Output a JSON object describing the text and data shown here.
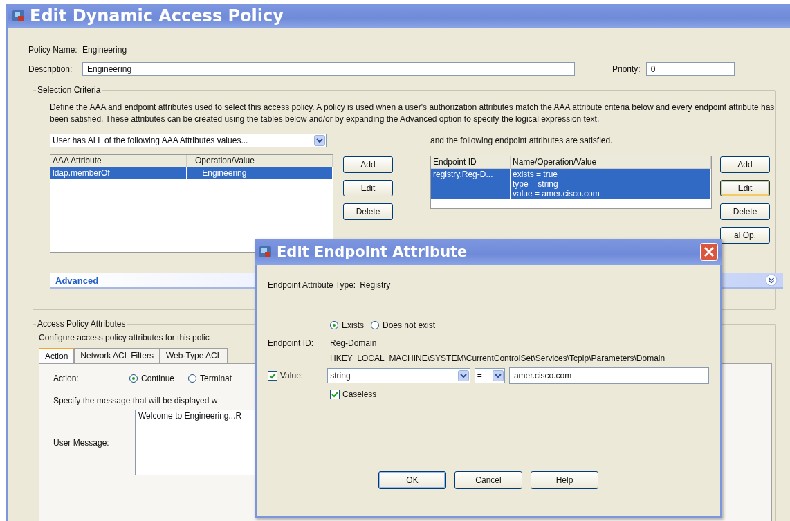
{
  "window": {
    "title": "Edit Dynamic Access Policy"
  },
  "policy_name": {
    "label": "Policy Name:",
    "value": "Engineering"
  },
  "description": {
    "label": "Description:",
    "value": "Engineering"
  },
  "priority": {
    "label": "Priority:",
    "value": "0"
  },
  "selection_criteria": {
    "title": "Selection Criteria",
    "text": "Define the AAA and endpoint attributes used to select this access policy. A policy is used when a user's authorization attributes match the AAA attribute criteria below and every endpoint attribute has been satisfied. These attributes can be created using the tables below and/or by expanding the Advanced option to specify the logical expression text.",
    "aaa_dropdown": "User has ALL of the following AAA Attributes values...",
    "aaa_table": {
      "columns": [
        "AAA Attribute",
        "Operation/Value"
      ],
      "rows": [
        {
          "cells": [
            "ldap.memberOf",
            "=  Engineering"
          ],
          "selected": true
        }
      ]
    },
    "aaa_buttons": [
      {
        "label": "Add",
        "focused": false
      },
      {
        "label": "Edit",
        "focused": false
      },
      {
        "label": "Delete",
        "focused": false
      }
    ],
    "endpoint_caption": "and the following endpoint attributes are satisfied.",
    "endpoint_table": {
      "columns": [
        "Endpoint ID",
        "Name/Operation/Value"
      ],
      "rows": [
        {
          "cells": [
            "registry.Reg-D...",
            [
              "exists = true",
              "type = string",
              "value = amer.cisco.com"
            ]
          ],
          "selected": true
        }
      ]
    },
    "endpoint_buttons": [
      {
        "label": "Add",
        "focused": false
      },
      {
        "label": "Edit",
        "focused": true
      },
      {
        "label": "Delete",
        "focused": false
      },
      {
        "label": "al Op.",
        "focused": false
      }
    ],
    "advanced": {
      "label": "Advanced",
      "expanded": false
    }
  },
  "access_policy_attributes": {
    "title": "Access Policy Attributes",
    "text": "Configure access policy attributes for this polic",
    "tabs": [
      {
        "label": "Action",
        "selected": true
      },
      {
        "label": "Network ACL Filters",
        "selected": false
      },
      {
        "label": "Web-Type ACL",
        "selected": false
      }
    ],
    "action": {
      "label": "Action:",
      "options": [
        {
          "label": "Continue",
          "selected": true
        },
        {
          "label": "Terminat",
          "selected": false
        }
      ]
    },
    "message_prompt": "Specify the message that will be displayed w",
    "user_message": {
      "label": "User Message:",
      "value": "Welcome to Engineering...R"
    }
  },
  "dialog": {
    "title": "Edit Endpoint Attribute",
    "type_label": "Endpoint Attribute Type:",
    "type_value": "Registry",
    "existence": [
      {
        "label": "Exists",
        "selected": true
      },
      {
        "label": "Does not exist",
        "selected": false
      }
    ],
    "endpoint_id_label": "Endpoint ID:",
    "endpoint_id": "Reg-Domain",
    "registry_path": "HKEY_LOCAL_MACHINE\\SYSTEM\\CurrentControlSet\\Services\\Tcpip\\Parameters\\Domain",
    "value_checkbox": {
      "label": "Value:",
      "checked": true
    },
    "value_type": "string",
    "operator": "=",
    "value": "amer.cisco.com",
    "caseless": {
      "label": "Caseless",
      "checked": true
    },
    "buttons": [
      {
        "label": "OK",
        "focused": true
      },
      {
        "label": "Cancel",
        "focused": false
      },
      {
        "label": "Help",
        "focused": false
      }
    ]
  }
}
